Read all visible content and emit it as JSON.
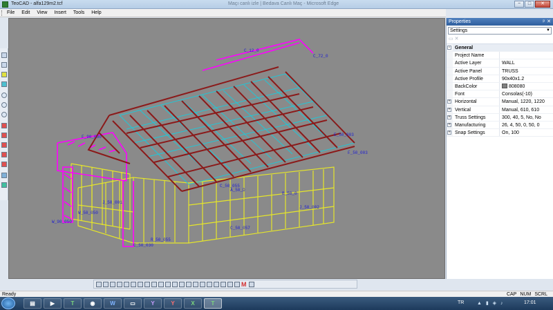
{
  "window": {
    "title": "TeoCAD - alfa129m2.tcf",
    "background_title": "Maçı canlı izle | Bedava Canlı Maç - Microsoft Edge",
    "controls": [
      "−",
      "□",
      "✕"
    ]
  },
  "menu": {
    "items": [
      "File",
      "Edit",
      "View",
      "Insert",
      "Tools",
      "Help"
    ]
  },
  "viewport": {
    "background": "#8a8a8a",
    "labels": [
      "C_72_0",
      "C_12_0",
      "F_50_003",
      "E_50_003",
      "J_50_002",
      "J_50_001",
      "W_90_050",
      "W_50_050",
      "R_50_055",
      "C_50_055",
      "C_50_057",
      "C_50_030",
      "F_90_030",
      "A_50_D",
      "B_50_0"
    ]
  },
  "properties": {
    "panel_title": "Properties",
    "pin": "ᵖ",
    "close": "✕",
    "selector_value": "Settings",
    "category_general": "General",
    "rows": [
      {
        "key": "Project Name",
        "value": "",
        "expandable": false
      },
      {
        "key": "Active Layer",
        "value": "WALL",
        "expandable": false
      },
      {
        "key": "Active Panel",
        "value": "TRUSS",
        "expandable": false
      },
      {
        "key": "Active Profile",
        "value": "90x40x1.2",
        "expandable": false
      },
      {
        "key": "BackColor",
        "value": "808080",
        "expandable": false,
        "color": "#808080"
      },
      {
        "key": "Font",
        "value": "Consolas(-10)",
        "expandable": false
      },
      {
        "key": "Horizontal",
        "value": "Manual, 1220, 1220",
        "expandable": true
      },
      {
        "key": "Vertical",
        "value": "Manual, 610, 610",
        "expandable": true
      },
      {
        "key": "Truss Settings",
        "value": "300, 40, 5, No, No",
        "expandable": true
      },
      {
        "key": "Manufacturing",
        "value": "26, 4, 50, 0, 50, 0",
        "expandable": true
      },
      {
        "key": "Snap Settings",
        "value": "On, 100",
        "expandable": true
      }
    ]
  },
  "statusbar": {
    "ready": "Ready",
    "cap": "CAP",
    "num": "NUM",
    "scrl": "SCRL"
  },
  "taskbar": {
    "lang": "TR",
    "clock": "17:01",
    "apps": [
      "explorer",
      "media",
      "teocad",
      "chrome",
      "word",
      "notes",
      "yahoo",
      "yandex",
      "excel",
      "teocad-active"
    ]
  },
  "colors": {
    "wall": "#e6e62a",
    "roof": "#8b1a1a",
    "truss": "#ff00ff",
    "rafter_cyan": "#22c6d6",
    "label": "#2020d0"
  }
}
